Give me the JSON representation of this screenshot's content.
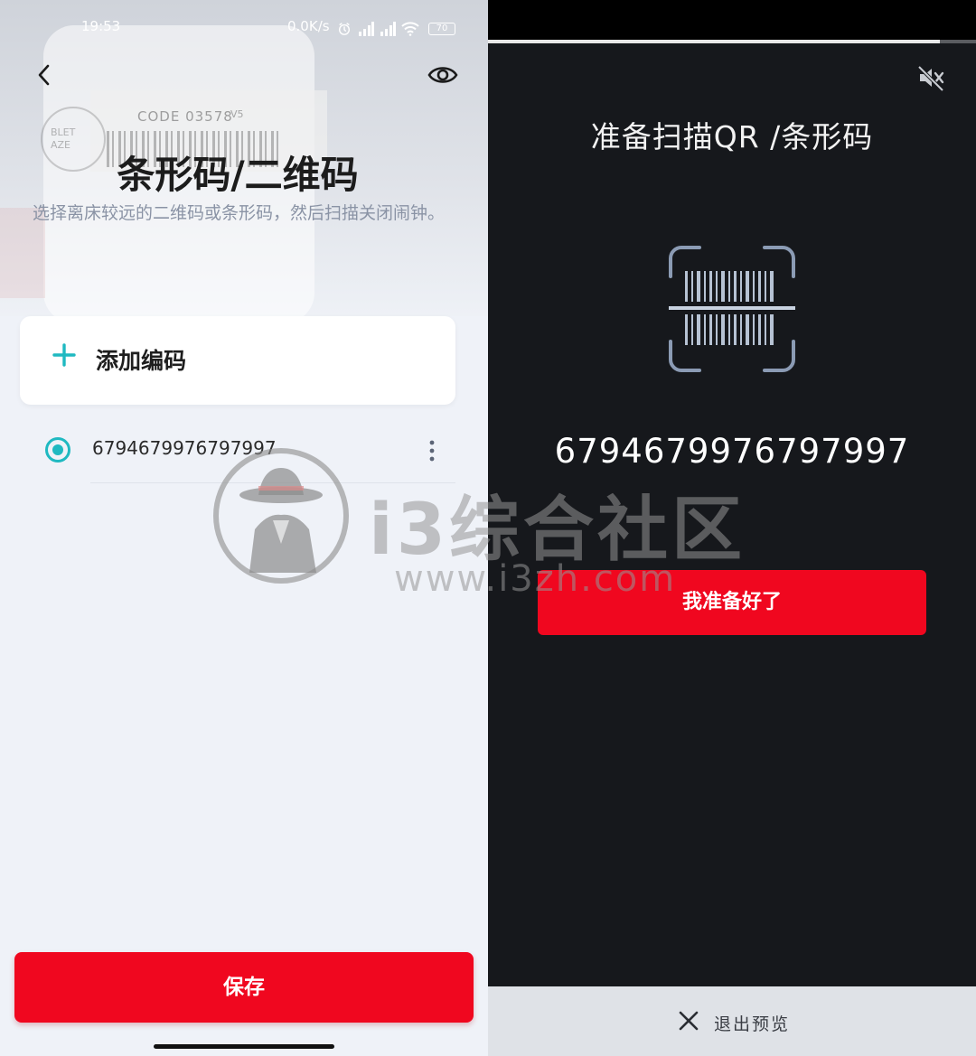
{
  "left_screen": {
    "status": {
      "time": "19:53",
      "speed": "0.0K/s",
      "battery": "70"
    },
    "hero": {
      "code_text": "CODE 03578",
      "code_suffix": "V5",
      "seal_text": "BLET\nAZE"
    },
    "title": "条形码/二维码",
    "subtitle": "选择离床较远的二维码或条形码，然后扫描关闭闹钟。",
    "add_label": "添加编码",
    "codes": [
      {
        "value": "6794679976797997",
        "selected": true
      }
    ],
    "save_label": "保存",
    "colors": {
      "accent": "#1fb9c1",
      "primary": "#f0071f"
    }
  },
  "right_screen": {
    "title": "准备扫描QR /条形码",
    "code": "6794679976797997",
    "ready_label": "我准备好了",
    "exit_label": "退出预览",
    "colors": {
      "background": "#16181c",
      "primary": "#f0071f"
    }
  },
  "watermark": {
    "name": "i3综合社区",
    "url": "www.i3zh.com"
  }
}
